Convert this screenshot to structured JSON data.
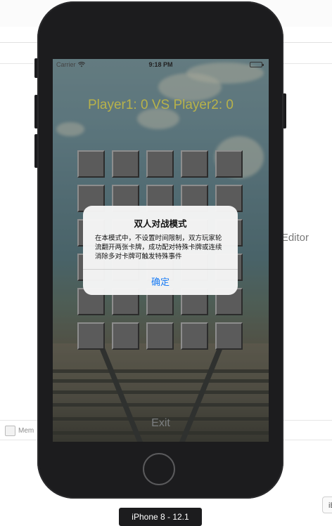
{
  "status_bar": {
    "carrier": "Carrier",
    "time": "9:18 PM"
  },
  "game": {
    "score_text": "Player1: 0 VS Player2: 0",
    "exit_label": "Exit",
    "grid_rows": 6,
    "grid_cols": 5
  },
  "alert": {
    "title": "双人对战模式",
    "message": "在本模式中，不设置时间限制，双方玩家轮流翻开两张卡牌，成功配对特殊卡牌或连续消除多对卡牌可触发特殊事件",
    "confirm_label": "确定"
  },
  "simulator": {
    "device_label": "iPhone 8 - 12.1"
  },
  "xcode": {
    "editor_label": "Editor",
    "memory_label": "Mem",
    "ib_label": "iB"
  },
  "colors": {
    "score_text": "#b8b24a",
    "card_face": "#5b5b5b",
    "alert_button": "#1a7cf5",
    "phone_body": "#1c1c1e"
  },
  "icons": {
    "wifi": "wifi-icon",
    "battery": "battery-icon",
    "home_button": "home-button-icon"
  }
}
